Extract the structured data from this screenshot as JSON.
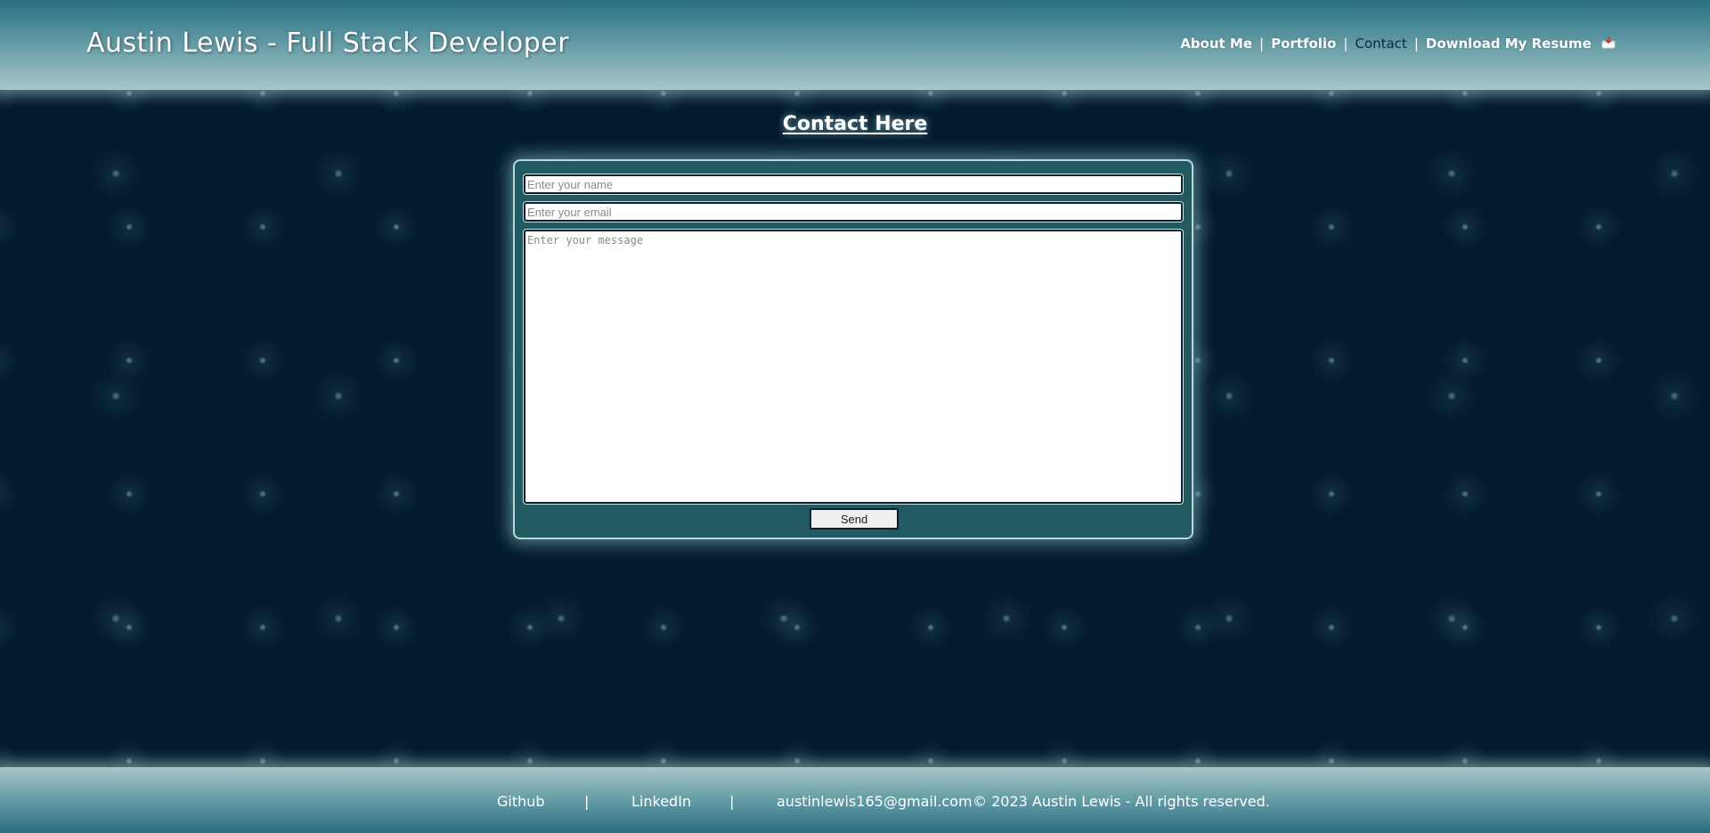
{
  "header": {
    "title": "Austin Lewis - Full Stack Developer",
    "nav": {
      "about": "About Me",
      "portfolio": "Portfolio",
      "contact": "Contact",
      "resume": "Download My Resume",
      "separator": "|",
      "resume_icon": "download-tray-icon",
      "active_item": "Contact"
    }
  },
  "main": {
    "heading": "Contact Here",
    "form": {
      "name_placeholder": "Enter your name",
      "name_value": "",
      "email_placeholder": "Enter your email",
      "email_value": "",
      "message_placeholder": "Enter your message",
      "message_value": "",
      "send_label": "Send"
    }
  },
  "footer": {
    "github": "Github",
    "linkedin": "LinkedIn",
    "separator": "|",
    "email": "austinlewis165@gmail.com",
    "copyright": "© 2023 Austin Lewis - All rights reserved."
  },
  "colors": {
    "background": "#021b2e",
    "header_top": "#2a6f80",
    "header_bottom": "#a9c7c9",
    "form_panel": "#225a62",
    "active_nav": "#0d2a3c"
  }
}
